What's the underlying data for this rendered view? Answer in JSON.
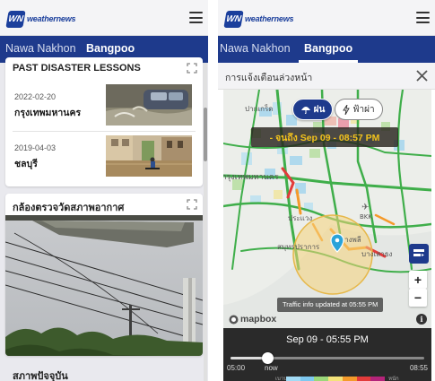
{
  "left": {
    "logo_text": "weathernews",
    "logo_mark": "WN",
    "tabs": [
      {
        "label": "Nawa Nakhon",
        "active": false
      },
      {
        "label": "Bangpoo",
        "active": true
      }
    ],
    "lessons_card": {
      "title": "PAST DISASTER LESSONS",
      "items": [
        {
          "date": "2022-02-20",
          "place": "กรุงเทพมหานคร"
        },
        {
          "date": "2019-04-03",
          "place": "ชลบุรี"
        }
      ]
    },
    "camera_card": {
      "title": "กล้องตรวจวัดสภาพอากาศ"
    },
    "current_title": "สภาพปัจจุบัน"
  },
  "right": {
    "logo_text": "weathernews",
    "logo_mark": "WN",
    "tabs": [
      {
        "label": "Nawa Nakhon",
        "active": false
      },
      {
        "label": "Bangpoo",
        "active": true
      }
    ],
    "alert_title": "การแจ้งเตือนล่วงหน้า",
    "rain_label": "ฝน",
    "lightning_label": "ฟ้าผ่า",
    "forecast_banner": "- จนถึง Sep 09 - 08:57 PM",
    "map_labels": {
      "district_1": "ปากเกร็ด",
      "district_2": "กรุงเทพมหานคร",
      "district_3": "ประแวง",
      "district_4": "สมุทรปราการ",
      "district_5": "บางพลี",
      "district_6": "บางเสาธง",
      "airport": "BKK"
    },
    "zoom_in": "+",
    "zoom_out": "−",
    "traffic_note": "Traffic info updated at 05:55 PM",
    "mapbox_label": "mapbox",
    "info_label": "i",
    "timeline": {
      "current_time": "Sep 09 - 05:55 PM",
      "start_label": "05:00",
      "now_label": "now",
      "end_label": "08:55",
      "progress": 0.19,
      "legend_left": "เบาบาง",
      "legend_right": "หนัก"
    },
    "colors": {
      "brand_navy": "#1e3a8c",
      "banner_yellow": "#f2c21c",
      "pin_blue": "#2aa3d9"
    }
  }
}
